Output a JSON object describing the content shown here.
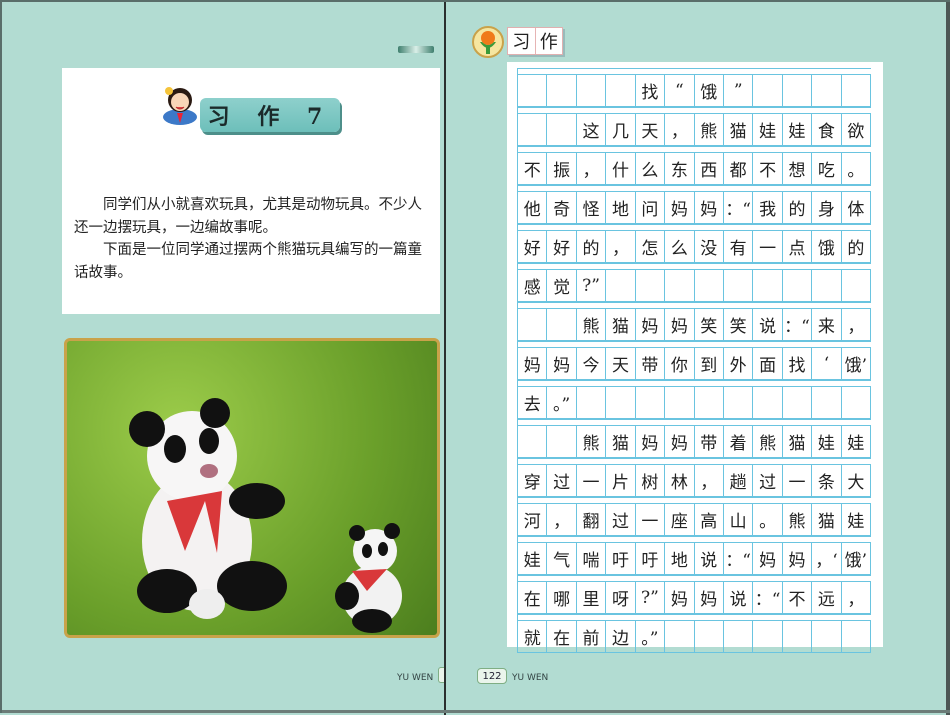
{
  "left_page": {
    "title": "习 作 7",
    "intro": [
      "同学们从小就喜欢玩具，尤其是动物玩具。不少人还一边摆玩具，一边编故事呢。",
      "下面是一位同学通过摆两个熊猫玩具编写的一篇童话故事。"
    ],
    "footer": "YU WEN"
  },
  "right_page": {
    "section_label": [
      "习",
      "作"
    ],
    "page_number": "122",
    "footer": "YU WEN",
    "grid_rows": [
      [
        "",
        "",
        "",
        "",
        "找",
        "“",
        "饿",
        "”",
        "",
        "",
        "",
        ""
      ],
      [
        "",
        "",
        "这",
        "几",
        "天",
        "，",
        "熊",
        "猫",
        "娃",
        "娃",
        "食",
        "欲"
      ],
      [
        "不",
        "振",
        "，",
        "什",
        "么",
        "东",
        "西",
        "都",
        "不",
        "想",
        "吃",
        "。"
      ],
      [
        "他",
        "奇",
        "怪",
        "地",
        "问",
        "妈",
        "妈",
        "：“",
        "我",
        "的",
        "身",
        "体"
      ],
      [
        "好",
        "好",
        "的",
        "，",
        "怎",
        "么",
        "没",
        "有",
        "一",
        "点",
        "饿",
        "的"
      ],
      [
        "感",
        "觉",
        "?”",
        "",
        "",
        "",
        "",
        "",
        "",
        "",
        "",
        ""
      ],
      [
        "",
        "",
        "熊",
        "猫",
        "妈",
        "妈",
        "笑",
        "笑",
        "说",
        "：“",
        "来",
        "，"
      ],
      [
        "妈",
        "妈",
        "今",
        "天",
        "带",
        "你",
        "到",
        "外",
        "面",
        "找",
        "‘",
        "饿’"
      ],
      [
        "去",
        "。”",
        "",
        "",
        "",
        "",
        "",
        "",
        "",
        "",
        "",
        ""
      ],
      [
        "",
        "",
        "熊",
        "猫",
        "妈",
        "妈",
        "带",
        "着",
        "熊",
        "猫",
        "娃",
        "娃"
      ],
      [
        "穿",
        "过",
        "一",
        "片",
        "树",
        "林",
        "，",
        "趟",
        "过",
        "一",
        "条",
        "大"
      ],
      [
        "河",
        "，",
        "翻",
        "过",
        "一",
        "座",
        "高",
        "山",
        "。",
        "熊",
        "猫",
        "娃"
      ],
      [
        "娃",
        "气",
        "喘",
        "吁",
        "吁",
        "地",
        "说",
        "：“",
        "妈",
        "妈",
        "，‘",
        "饿’"
      ],
      [
        "在",
        "哪",
        "里",
        "呀",
        "?”",
        "妈",
        "妈",
        "说",
        "：“",
        "不",
        "远",
        "，"
      ],
      [
        "就",
        "在",
        "前",
        "边",
        "。”",
        "",
        "",
        "",
        "",
        "",
        "",
        ""
      ]
    ]
  }
}
